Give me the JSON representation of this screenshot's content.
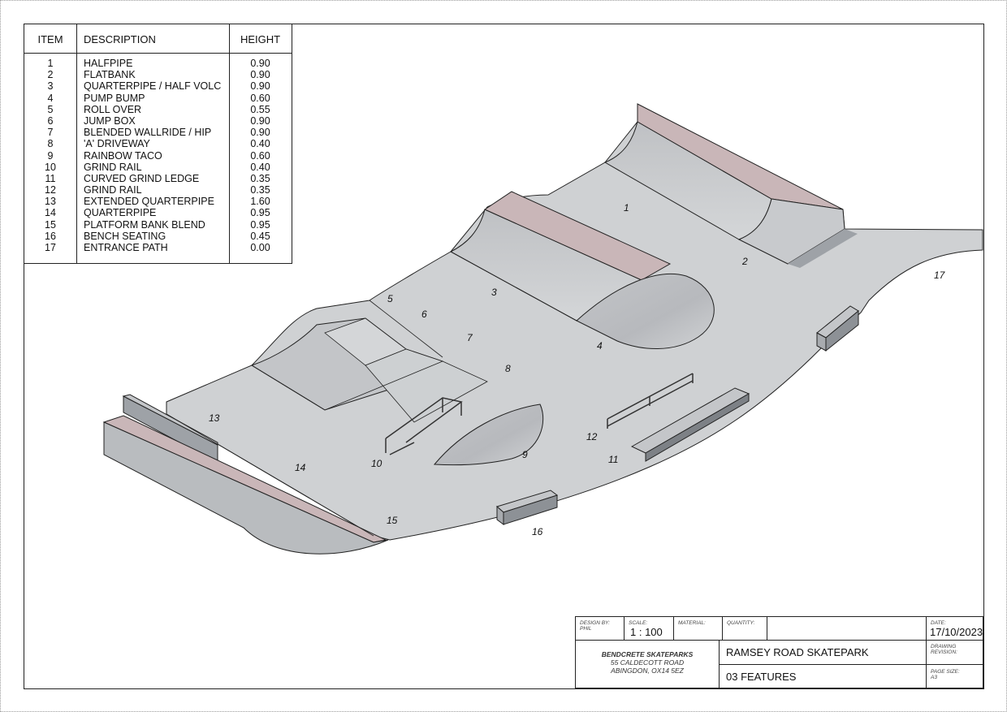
{
  "legend": {
    "headers": {
      "item": "ITEM",
      "description": "DESCRIPTION",
      "height": "HEIGHT"
    },
    "rows": [
      {
        "item": "1",
        "description": "HALFPIPE",
        "height": "0.90"
      },
      {
        "item": "2",
        "description": "FLATBANK",
        "height": "0.90"
      },
      {
        "item": "3",
        "description": "QUARTERPIPE / HALF VOLC",
        "height": "0.90"
      },
      {
        "item": "4",
        "description": "PUMP BUMP",
        "height": "0.60"
      },
      {
        "item": "5",
        "description": "ROLL OVER",
        "height": "0.55"
      },
      {
        "item": "6",
        "description": "JUMP BOX",
        "height": "0.90"
      },
      {
        "item": "7",
        "description": "BLENDED WALLRIDE / HIP",
        "height": "0.90"
      },
      {
        "item": "8",
        "description": "'A' DRIVEWAY",
        "height": "0.40"
      },
      {
        "item": "9",
        "description": "RAINBOW TACO",
        "height": "0.60"
      },
      {
        "item": "10",
        "description": "GRIND RAIL",
        "height": "0.40"
      },
      {
        "item": "11",
        "description": "CURVED GRIND LEDGE",
        "height": "0.35"
      },
      {
        "item": "12",
        "description": "GRIND RAIL",
        "height": "0.35"
      },
      {
        "item": "13",
        "description": "EXTENDED QUARTERPIPE",
        "height": "1.60"
      },
      {
        "item": "14",
        "description": "QUARTERPIPE",
        "height": "0.95"
      },
      {
        "item": "15",
        "description": "PLATFORM BANK BLEND",
        "height": "0.95"
      },
      {
        "item": "16",
        "description": "BENCH SEATING",
        "height": "0.45"
      },
      {
        "item": "17",
        "description": "ENTRANCE PATH",
        "height": "0.00"
      }
    ]
  },
  "plan_labels": [
    "1",
    "2",
    "3",
    "4",
    "5",
    "6",
    "7",
    "8",
    "9",
    "10",
    "11",
    "12",
    "13",
    "14",
    "15",
    "16",
    "17"
  ],
  "colors": {
    "concrete": "#cfd1d3",
    "concrete_dark": "#b4b6b9",
    "coping": "#c9b6b8",
    "line": "#222222"
  },
  "title_block": {
    "design_by_label": "DESIGN BY:",
    "design_by": "PHIL",
    "scale_label": "SCALE:",
    "scale": "1 : 100",
    "material_label": "MATERIAL:",
    "quantity_label": "QUANTITY:",
    "date_label": "DATE:",
    "date": "17/10/2023",
    "company": "BENDCRETE SKATEPARKS",
    "address1": "55 CALDECOTT ROAD",
    "address2": "ABINGDON, OX14 5EZ",
    "project": "RAMSEY ROAD SKATEPARK",
    "sheet": "03 FEATURES",
    "revision_label": "DRAWING REVISION:",
    "page_size_label": "PAGE SIZE:",
    "page_size": "A3"
  }
}
